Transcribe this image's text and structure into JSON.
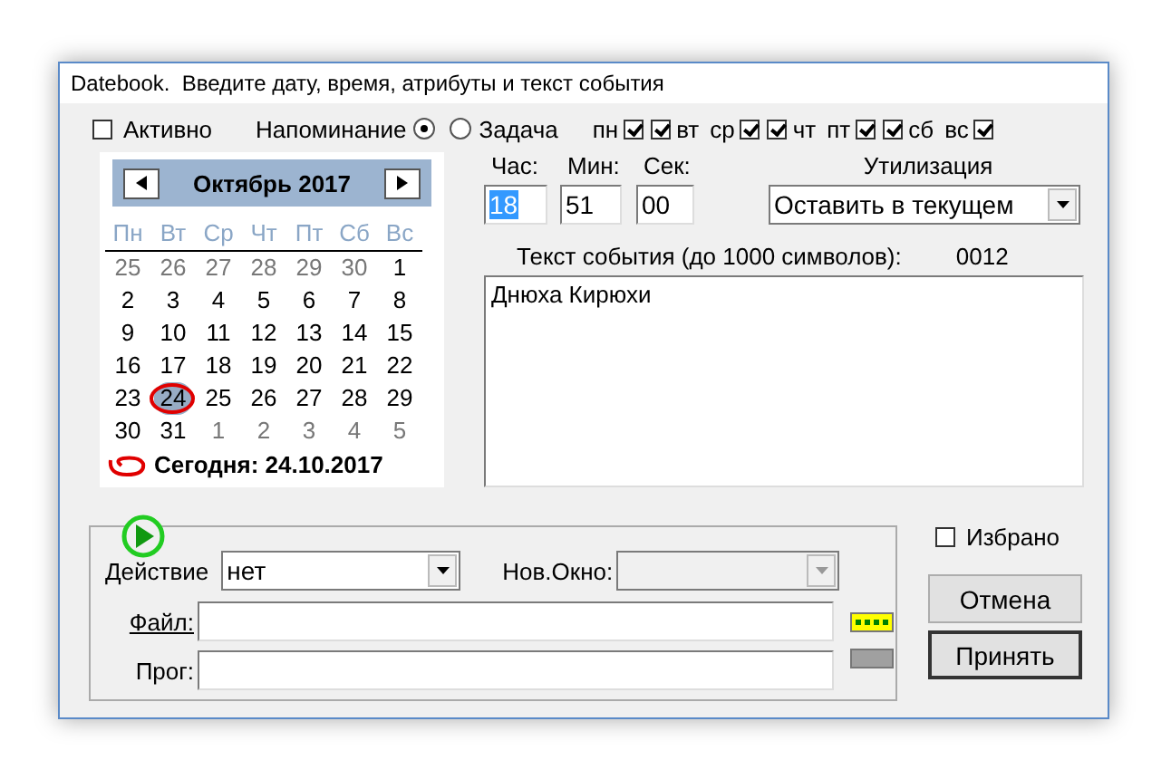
{
  "window": {
    "title": "Datebook.  Введите дату, время, атрибуты и текст события"
  },
  "active": {
    "label": "Активно",
    "checked": false
  },
  "mode": [
    {
      "label": "Напоминание",
      "kind": "before",
      "selected": true
    },
    {
      "label": "Задача",
      "kind": "after",
      "selected": false
    }
  ],
  "weekdays": [
    {
      "label": "пн",
      "kind": "after",
      "checked": true
    },
    {
      "label": "вт",
      "kind": "before",
      "checked": true
    },
    {
      "label": "ср",
      "kind": "after",
      "checked": true
    },
    {
      "label": "чт",
      "kind": "before",
      "checked": true
    },
    {
      "label": "пт",
      "kind": "after",
      "checked": true
    },
    {
      "label": "сб",
      "kind": "before",
      "checked": true
    },
    {
      "label": "вс",
      "kind": "after",
      "checked": true
    }
  ],
  "calendar": {
    "month": "Октябрь 2017",
    "weekday_headers": [
      "Пн",
      "Вт",
      "Ср",
      "Чт",
      "Пт",
      "Сб",
      "Вс"
    ],
    "weeks": [
      [
        {
          "day": "25",
          "outside": true,
          "selected": false
        },
        {
          "day": "26",
          "outside": true,
          "selected": false
        },
        {
          "day": "27",
          "outside": true,
          "selected": false
        },
        {
          "day": "28",
          "outside": true,
          "selected": false
        },
        {
          "day": "29",
          "outside": true,
          "selected": false
        },
        {
          "day": "30",
          "outside": true,
          "selected": false
        },
        {
          "day": "1",
          "outside": false,
          "selected": false
        }
      ],
      [
        {
          "day": "2",
          "outside": false,
          "selected": false
        },
        {
          "day": "3",
          "outside": false,
          "selected": false
        },
        {
          "day": "4",
          "outside": false,
          "selected": false
        },
        {
          "day": "5",
          "outside": false,
          "selected": false
        },
        {
          "day": "6",
          "outside": false,
          "selected": false
        },
        {
          "day": "7",
          "outside": false,
          "selected": false
        },
        {
          "day": "8",
          "outside": false,
          "selected": false
        }
      ],
      [
        {
          "day": "9",
          "outside": false,
          "selected": false
        },
        {
          "day": "10",
          "outside": false,
          "selected": false
        },
        {
          "day": "11",
          "outside": false,
          "selected": false
        },
        {
          "day": "12",
          "outside": false,
          "selected": false
        },
        {
          "day": "13",
          "outside": false,
          "selected": false
        },
        {
          "day": "14",
          "outside": false,
          "selected": false
        },
        {
          "day": "15",
          "outside": false,
          "selected": false
        }
      ],
      [
        {
          "day": "16",
          "outside": false,
          "selected": false
        },
        {
          "day": "17",
          "outside": false,
          "selected": false
        },
        {
          "day": "18",
          "outside": false,
          "selected": false
        },
        {
          "day": "19",
          "outside": false,
          "selected": false
        },
        {
          "day": "20",
          "outside": false,
          "selected": false
        },
        {
          "day": "21",
          "outside": false,
          "selected": false
        },
        {
          "day": "22",
          "outside": false,
          "selected": false
        }
      ],
      [
        {
          "day": "23",
          "outside": false,
          "selected": false
        },
        {
          "day": "24",
          "outside": false,
          "selected": true
        },
        {
          "day": "25",
          "outside": false,
          "selected": false
        },
        {
          "day": "26",
          "outside": false,
          "selected": false
        },
        {
          "day": "27",
          "outside": false,
          "selected": false
        },
        {
          "day": "28",
          "outside": false,
          "selected": false
        },
        {
          "day": "29",
          "outside": false,
          "selected": false
        }
      ],
      [
        {
          "day": "30",
          "outside": false,
          "selected": false
        },
        {
          "day": "31",
          "outside": false,
          "selected": false
        },
        {
          "day": "1",
          "outside": true,
          "selected": false
        },
        {
          "day": "2",
          "outside": true,
          "selected": false
        },
        {
          "day": "3",
          "outside": true,
          "selected": false
        },
        {
          "day": "4",
          "outside": true,
          "selected": false
        },
        {
          "day": "5",
          "outside": true,
          "selected": false
        }
      ]
    ],
    "today": "Сегодня: 24.10.2017"
  },
  "time": [
    {
      "label": "Час:",
      "value": "18",
      "selected": true
    },
    {
      "label": "Мин:",
      "value": "51",
      "selected": false
    },
    {
      "label": "Сек:",
      "value": "00",
      "selected": false
    }
  ],
  "utilization": {
    "label": "Утилизация",
    "value": "Оставить в текущем"
  },
  "event_text": {
    "label": "Текст события (до 1000 символов):",
    "counter": "0012",
    "value": "Днюха Кирюхи"
  },
  "action": {
    "label": "Действие",
    "value": "нет"
  },
  "new_window": {
    "label": "Нов.Окно:",
    "disabled": true
  },
  "file": {
    "label": "Файл:"
  },
  "prog": {
    "label": "Прог:"
  },
  "favorite": {
    "label": "Избрано",
    "checked": false
  },
  "buttons": [
    {
      "label": "Отмена",
      "default": false
    },
    {
      "label": "Принять",
      "default": true
    }
  ]
}
